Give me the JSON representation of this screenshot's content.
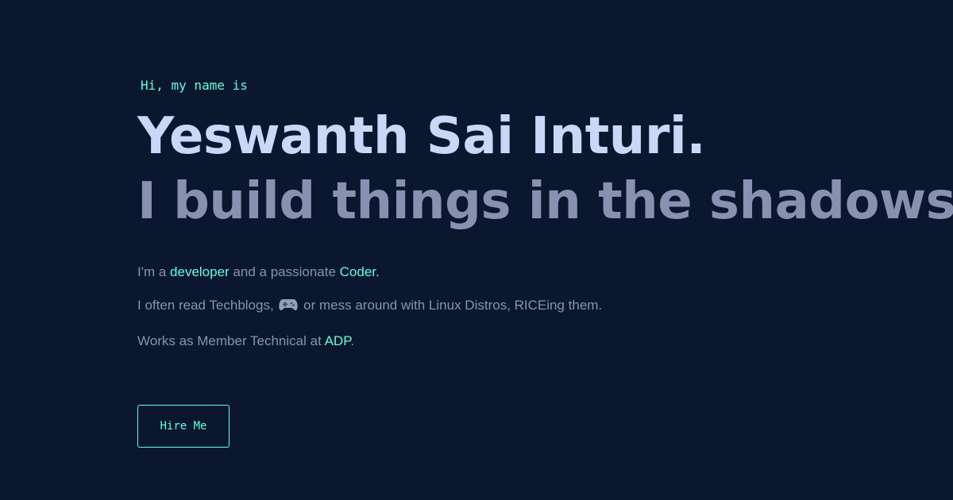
{
  "hero": {
    "greeting": "Hi, my name is",
    "name": "Yeswanth Sai Inturi.",
    "tagline": "I build things in the shadows."
  },
  "bio": {
    "line1": {
      "prefix": "I'm a ",
      "role": "developer",
      "middle": " and a passionate ",
      "passion": "Coder."
    },
    "line2": {
      "prefix": "I often read Techblogs, ",
      "icon": "gamepad-icon",
      "suffix": " or mess around with Linux Distros, RICEing them."
    },
    "line3": {
      "prefix": "Works as Member Technical at ",
      "company": "ADP",
      "suffix": "."
    }
  },
  "cta": {
    "label": "Hire Me"
  },
  "colors": {
    "background": "#0b172e",
    "accent": "#64ffda",
    "heading": "#ccd6f6",
    "muted": "#8892b0"
  }
}
